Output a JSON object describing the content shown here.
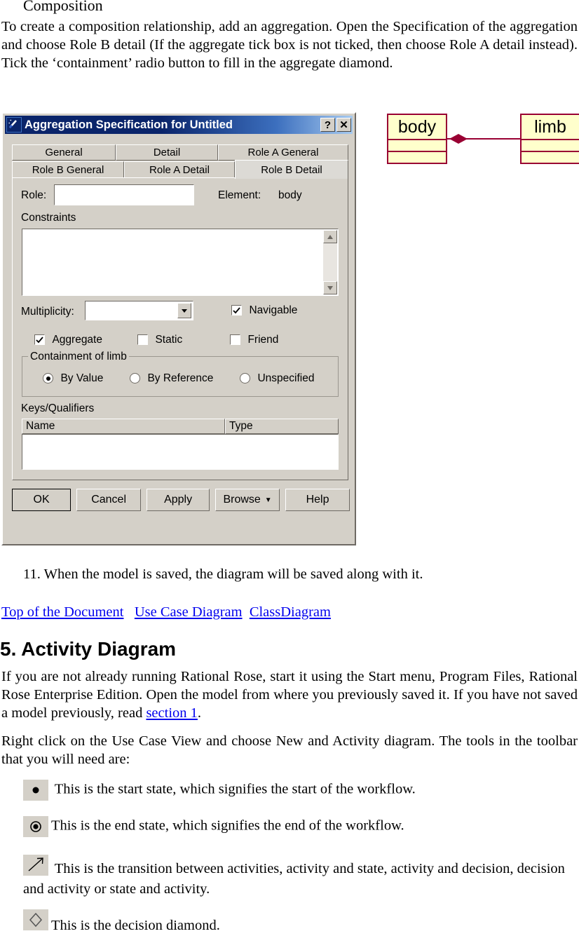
{
  "document": {
    "section_heading": "Composition",
    "intro_paragraph": "To create a composition relationship, add an aggregation. Open the Specification of the aggregation and choose Role B detail (If the aggregate tick box is not ticked, then choose Role A detail instead).  Tick the ‘containment’ radio button to fill in the aggregate diamond.",
    "step_11": "11. When the model is saved, the diagram will be saved along with it.",
    "nav_links": [
      {
        "label": "Top of the Document"
      },
      {
        "label": "Use Case Diagram"
      },
      {
        "label": "ClassDiagram"
      }
    ],
    "activity_heading": "5. Activity Diagram",
    "activity_para_1a": "If you are not already running Rational Rose, start it using the Start menu, Program Files, Rational Rose Enterprise Edition.  Open the model from where you previously saved it.  If you have not saved a model previously, read ",
    "activity_para_1_link": "section 1",
    "activity_para_1b": ".",
    "activity_para_2": "Right click on the Use Case View and choose New and Activity diagram.  The tools in the toolbar that you will need are:",
    "tools": [
      {
        "icon": "start-state-icon",
        "text": " This is the start state, which signifies the start of the workflow."
      },
      {
        "icon": "end-state-icon",
        "text": "This is the end state, which signifies the end of the workflow."
      },
      {
        "icon": "transition-arrow-icon",
        "text": " This is the transition between activities, activity and state, activity and decision, decision and activity or state and activity."
      },
      {
        "icon": "decision-diamond-icon",
        "text": "This is the decision diamond."
      }
    ],
    "link_color": "#0000ee"
  },
  "dialog": {
    "title": "Aggregation Specification for Untitled",
    "title_icon": "magic-wand-icon",
    "help_button": "?",
    "close_button": "✕",
    "tabs_row1": [
      {
        "label": "General",
        "active": false
      },
      {
        "label": "Detail",
        "active": false
      },
      {
        "label": "Role A General",
        "active": false
      }
    ],
    "tabs_row2": [
      {
        "label": "Role B General",
        "active": false
      },
      {
        "label": "Role A Detail",
        "active": false
      },
      {
        "label": "Role B Detail",
        "active": true
      }
    ],
    "role_label": "Role:",
    "role_value": "",
    "element_label": "Element:",
    "element_value": "body",
    "constraints_label": "Constraints",
    "constraints_value": "",
    "multiplicity_label": "Multiplicity:",
    "multiplicity_value": "",
    "checkboxes": [
      {
        "label": "Navigable",
        "checked": true
      },
      {
        "label": "Aggregate",
        "checked": true
      },
      {
        "label": "Static",
        "checked": false
      },
      {
        "label": "Friend",
        "checked": false
      }
    ],
    "containment_group_title": "Containment of limb",
    "containment_options": [
      {
        "label": "By Value",
        "selected": true
      },
      {
        "label": "By Reference",
        "selected": false
      },
      {
        "label": "Unspecified",
        "selected": false
      }
    ],
    "keys_label": "Keys/Qualifiers",
    "keys_columns": [
      "Name",
      "Type"
    ],
    "keys_rows": [],
    "buttons": [
      {
        "label": "OK",
        "default": true
      },
      {
        "label": "Cancel",
        "default": false
      },
      {
        "label": "Apply",
        "default": false
      },
      {
        "label": "Browse",
        "default": false,
        "caret": "▼"
      },
      {
        "label": "Help",
        "default": false
      }
    ],
    "colors": {
      "face": "#d4d0c8",
      "titlebar_start": "#0a246a",
      "titlebar_end": "#a6caf0"
    }
  },
  "uml_diagram": {
    "classes": [
      {
        "name": "body",
        "compartments": 2
      },
      {
        "name": "limb",
        "compartments": 2
      }
    ],
    "relationship": {
      "type": "composition",
      "diamond": "filled",
      "source": "body",
      "target": "limb"
    },
    "colors": {
      "fill": "#ffffcc",
      "stroke": "#990033"
    }
  }
}
